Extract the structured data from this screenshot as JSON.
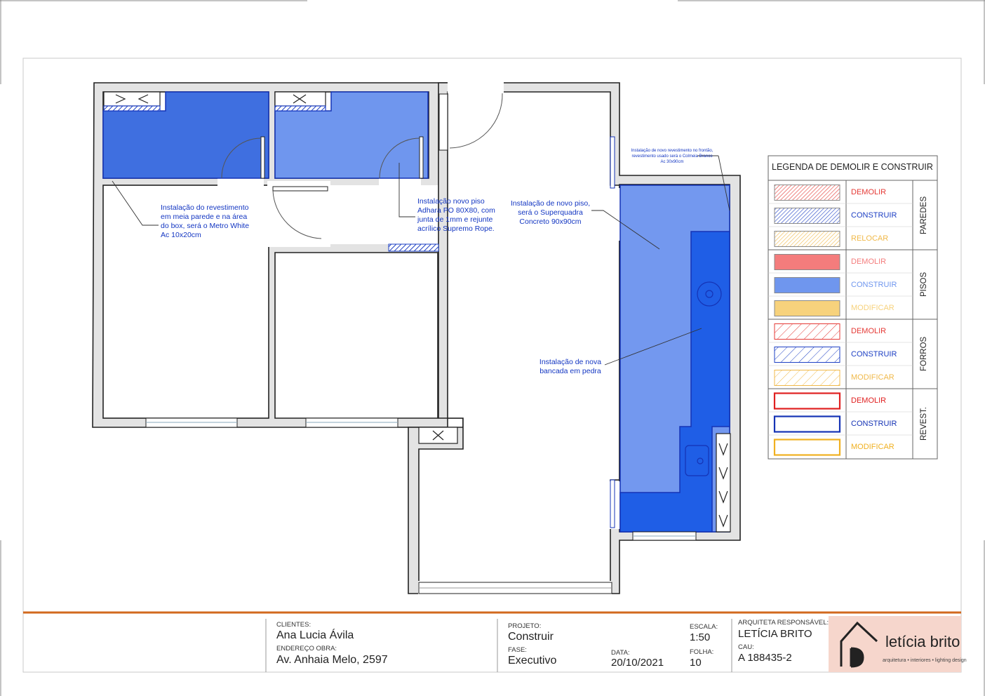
{
  "notes": {
    "bathroom_wall": "Instalação do revestimento em meia parede e na área do box, será o Metro White Ac 10x20cm",
    "bathroom_floor": "Instalação novo piso Adhara PO 80X80, com junta de 1mm e rejunte acrílico Supremo Rope.",
    "kitchen_floor": "Instalação de novo piso, será o Superquadra Concreto 90x90cm",
    "frontao": "Instalação de novo revestimento no frontão, revestimento usado será o Colmeia Branco Ac 30x90cm",
    "countertop": "Instalação de nova bancada em pedra"
  },
  "legend": {
    "title": "LEGENDA DE DEMOLIR E CONSTRUIR",
    "groups": [
      {
        "name": "PAREDES",
        "items": [
          {
            "label": "DEMOLIR",
            "style": "hatch-dense",
            "color": "#e53935"
          },
          {
            "label": "CONSTRUIR",
            "style": "hatch-dense",
            "color": "#1e40c4"
          },
          {
            "label": "RELOCAR",
            "style": "hatch-dense",
            "color": "#f0b94a"
          }
        ]
      },
      {
        "name": "PISOS",
        "items": [
          {
            "label": "DEMOLIR",
            "style": "fill",
            "color": "#f47c7c"
          },
          {
            "label": "CONSTRUIR",
            "style": "fill",
            "color": "#6f96ee"
          },
          {
            "label": "MODIFICAR",
            "style": "fill",
            "color": "#f7d27c"
          }
        ]
      },
      {
        "name": "FORROS",
        "items": [
          {
            "label": "DEMOLIR",
            "style": "hatch-sparse",
            "color": "#e53935"
          },
          {
            "label": "CONSTRUIR",
            "style": "hatch-sparse",
            "color": "#1e40c4"
          },
          {
            "label": "MODIFICAR",
            "style": "hatch-sparse",
            "color": "#f0b94a"
          }
        ]
      },
      {
        "name": "REVEST.",
        "items": [
          {
            "label": "DEMOLIR",
            "style": "outline",
            "color": "#e02020"
          },
          {
            "label": "CONSTRUIR",
            "style": "outline",
            "color": "#1533b5"
          },
          {
            "label": "MODIFICAR",
            "style": "outline",
            "color": "#f0b020"
          }
        ]
      }
    ]
  },
  "title_block": {
    "clients_label": "CLIENTES:",
    "client": "Ana Lucia Ávila",
    "address_label": "ENDEREÇO OBRA:",
    "address": "Av. Anhaia Melo, 2597",
    "project_label": "PROJETO:",
    "project": "Construir",
    "phase_label": "FASE:",
    "phase": "Executivo",
    "date_label": "DATA:",
    "date": "20/10/2021",
    "scale_label": "ESCALA:",
    "scale": "1:50",
    "sheet_label": "FOLHA:",
    "sheet": "10",
    "architect_label": "ARQUITETA RESPONSÁVEL:",
    "architect": "LETÍCIA BRITO",
    "cau_label": "CAU:",
    "cau": "A 188435-2"
  },
  "logo": {
    "name": "letícia brito",
    "tagline": "arquitetura • interiores • lighting design"
  },
  "colors": {
    "wall_fill": "#e3e3e3",
    "floor_new": "#6f96ee",
    "countertop": "#1f5ee6",
    "annotation": "#1336c2",
    "rule_line": "#d2691e",
    "logo_bg": "#f6d6cc"
  }
}
